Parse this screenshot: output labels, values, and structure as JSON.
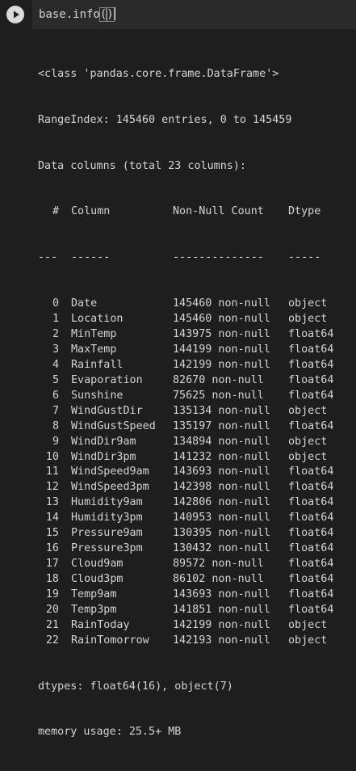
{
  "cell": {
    "code": "base.info",
    "code_open": "(",
    "code_close": ")"
  },
  "output": {
    "class_line": "<class 'pandas.core.frame.DataFrame'>",
    "range_line": "RangeIndex: 145460 entries, 0 to 145459",
    "columns_line": "Data columns (total 23 columns):",
    "headers": {
      "idx": "#",
      "column": "Column",
      "nonnull": "Non-Null Count",
      "dtype": "Dtype"
    },
    "separators": {
      "idx": "---",
      "column": "------",
      "nonnull": "--------------",
      "dtype": "-----"
    },
    "rows": [
      {
        "idx": "0",
        "column": "Date",
        "nonnull": "145460 non-null",
        "dtype": "object"
      },
      {
        "idx": "1",
        "column": "Location",
        "nonnull": "145460 non-null",
        "dtype": "object"
      },
      {
        "idx": "2",
        "column": "MinTemp",
        "nonnull": "143975 non-null",
        "dtype": "float64"
      },
      {
        "idx": "3",
        "column": "MaxTemp",
        "nonnull": "144199 non-null",
        "dtype": "float64"
      },
      {
        "idx": "4",
        "column": "Rainfall",
        "nonnull": "142199 non-null",
        "dtype": "float64"
      },
      {
        "idx": "5",
        "column": "Evaporation",
        "nonnull": "82670 non-null",
        "dtype": "float64"
      },
      {
        "idx": "6",
        "column": "Sunshine",
        "nonnull": "75625 non-null",
        "dtype": "float64"
      },
      {
        "idx": "7",
        "column": "WindGustDir",
        "nonnull": "135134 non-null",
        "dtype": "object"
      },
      {
        "idx": "8",
        "column": "WindGustSpeed",
        "nonnull": "135197 non-null",
        "dtype": "float64"
      },
      {
        "idx": "9",
        "column": "WindDir9am",
        "nonnull": "134894 non-null",
        "dtype": "object"
      },
      {
        "idx": "10",
        "column": "WindDir3pm",
        "nonnull": "141232 non-null",
        "dtype": "object"
      },
      {
        "idx": "11",
        "column": "WindSpeed9am",
        "nonnull": "143693 non-null",
        "dtype": "float64"
      },
      {
        "idx": "12",
        "column": "WindSpeed3pm",
        "nonnull": "142398 non-null",
        "dtype": "float64"
      },
      {
        "idx": "13",
        "column": "Humidity9am",
        "nonnull": "142806 non-null",
        "dtype": "float64"
      },
      {
        "idx": "14",
        "column": "Humidity3pm",
        "nonnull": "140953 non-null",
        "dtype": "float64"
      },
      {
        "idx": "15",
        "column": "Pressure9am",
        "nonnull": "130395 non-null",
        "dtype": "float64"
      },
      {
        "idx": "16",
        "column": "Pressure3pm",
        "nonnull": "130432 non-null",
        "dtype": "float64"
      },
      {
        "idx": "17",
        "column": "Cloud9am",
        "nonnull": "89572 non-null",
        "dtype": "float64"
      },
      {
        "idx": "18",
        "column": "Cloud3pm",
        "nonnull": "86102 non-null",
        "dtype": "float64"
      },
      {
        "idx": "19",
        "column": "Temp9am",
        "nonnull": "143693 non-null",
        "dtype": "float64"
      },
      {
        "idx": "20",
        "column": "Temp3pm",
        "nonnull": "141851 non-null",
        "dtype": "float64"
      },
      {
        "idx": "21",
        "column": "RainToday",
        "nonnull": "142199 non-null",
        "dtype": "object"
      },
      {
        "idx": "22",
        "column": "RainTomorrow",
        "nonnull": "142193 non-null",
        "dtype": "object"
      }
    ],
    "dtypes_line": "dtypes: float64(16), object(7)",
    "memory_line": "memory usage: 25.5+ MB"
  },
  "colors": {
    "background": "#1e1e1e",
    "code_background": "#2a2a2a",
    "text": "#d4d4d4",
    "run_button": "#dadada"
  },
  "icons": {
    "run": "play-icon"
  }
}
